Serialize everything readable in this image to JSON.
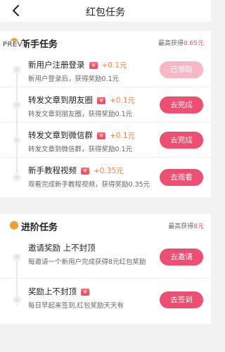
{
  "header": {
    "title": "红包任务",
    "back_icon": "chevron-left-icon"
  },
  "overlay": {
    "prev_label": "PREV"
  },
  "sections": [
    {
      "title": "新手任务",
      "max_label": "最高获得",
      "max_amount": "0.65元",
      "icon": "coin-icon",
      "tasks": [
        {
          "title": "新用户注册登录",
          "reward": "+0.1元",
          "desc": "新用户登录后，获得奖励0.1元",
          "button": "已领取",
          "state": "claimed"
        },
        {
          "title": "转发文章到朋友圈",
          "reward": "+0.1元",
          "desc": "转发文章到朋友圈，获得奖励0.1元",
          "button": "去完成",
          "state": "active"
        },
        {
          "title": "转发文章到微信群",
          "reward": "+0.1元",
          "desc": "转发文章到微信群，获得奖励0.1元",
          "button": "去完成",
          "state": "active"
        },
        {
          "title": "新手教程视频",
          "reward": "+0.35元",
          "desc": "观看完成新手教程视频，获得奖励0.35元",
          "button": "去观看",
          "state": "active"
        }
      ]
    },
    {
      "title": "进阶任务",
      "max_label": "最高获得",
      "max_amount": "8元",
      "icon": "coin-icon",
      "tasks": [
        {
          "title": "邀请奖励 上不封顶",
          "reward": "",
          "desc": "每邀请一个新用户完成获得8元红包奖励",
          "button": "去邀请",
          "state": "active"
        },
        {
          "title": "奖励上不封顶",
          "reward": "",
          "desc": "每日早起来签到,红包奖励天天有",
          "button": "去签到",
          "state": "active"
        }
      ]
    }
  ],
  "colors": {
    "accent": "#ec4f72",
    "accent_disabled": "#f7b7c5",
    "reward": "#f0864b",
    "section_icon": "#f29d38"
  }
}
